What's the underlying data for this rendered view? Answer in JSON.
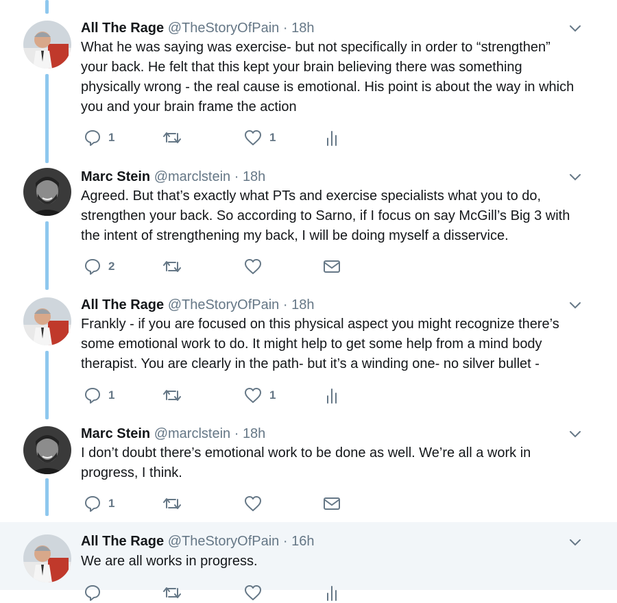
{
  "tweets": [
    {
      "name": "All The Rage",
      "handle": "@TheStoryOfPain",
      "sep": " · ",
      "time": "18h",
      "text": "What he was saying was exercise- but not specifically in order to “strengthen” your back.  He felt that this kept your brain believing there was something physically wrong - the real cause is emotional.  His point is about the way in which you and your brain frame the action",
      "replies": "1",
      "retweets": "",
      "likes": "1",
      "fourth_action": "analytics-icon"
    },
    {
      "name": "Marc Stein",
      "handle": "@marclstein",
      "sep": " · ",
      "time": "18h",
      "text": "Agreed. But that’s exactly what PTs and exercise specialists what you to do, strengthen your back. So according to Sarno, if I focus on say McGill’s Big 3 with the intent of strengthening my back, I will be doing myself a disservice.",
      "replies": "2",
      "retweets": "",
      "likes": "",
      "fourth_action": "envelope-icon"
    },
    {
      "name": "All The Rage",
      "handle": "@TheStoryOfPain",
      "sep": " · ",
      "time": "18h",
      "text": "Frankly - if you are focused on this physical aspect you might recognize there’s some emotional work to do.  It might help to get some help from a mind body therapist.  You are clearly in the path- but it’s a winding one- no silver bullet -",
      "replies": "1",
      "retweets": "",
      "likes": "1",
      "fourth_action": "analytics-icon"
    },
    {
      "name": "Marc Stein",
      "handle": "@marclstein",
      "sep": " · ",
      "time": "18h",
      "text": "I don’t doubt there’s emotional work to be done as well. We’re all a work in progress, I think.",
      "replies": "1",
      "retweets": "",
      "likes": "",
      "fourth_action": "envelope-icon"
    },
    {
      "name": "All The Rage",
      "handle": "@TheStoryOfPain",
      "sep": " · ",
      "time": "16h",
      "text": "We are all works in progress.",
      "replies": "",
      "retweets": "",
      "likes": "",
      "fourth_action": "analytics-icon"
    }
  ],
  "colors": {
    "thread_line": "#8ec7ee",
    "icon_gray": "#657786",
    "highlight_bg": "#f2f6f9"
  }
}
